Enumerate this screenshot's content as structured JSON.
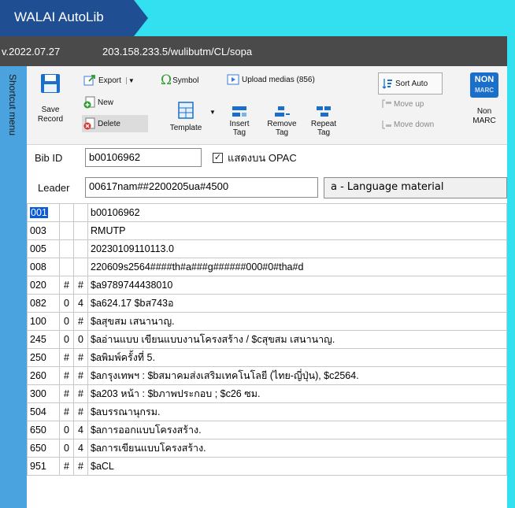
{
  "app": {
    "title": "WALAI AutoLib"
  },
  "infobar": {
    "version": "v.2022.07.27",
    "path": "203.158.233.5/wulibutm/CL/sopa"
  },
  "sidebar": {
    "label": "Shortcut menu"
  },
  "toolbar": {
    "save": "Save\nRecord",
    "save_line1": "Save",
    "save_line2": "Record",
    "export": "Export",
    "new": "New",
    "delete": "Delete",
    "symbol": "Symbol",
    "upload": "Upload medias (856)",
    "template": "Template",
    "insert_tag_1": "Insert",
    "insert_tag_2": "Tag",
    "remove_tag_1": "Remove",
    "remove_tag_2": "Tag",
    "repeat_tag_1": "Repeat",
    "repeat_tag_2": "Tag",
    "sort_auto": "Sort Auto",
    "move_up": "Move up",
    "move_down": "Move down",
    "nonmarc_badge_1": "NON",
    "nonmarc_badge_2": "MARC",
    "nonmarc_1": "Non",
    "nonmarc_2": "MARC"
  },
  "form": {
    "bib_id_label": "Bib ID",
    "bib_id_value": "b00106962",
    "opac_label": "แสดงบน OPAC",
    "opac_checked": true,
    "leader_label": "Leader",
    "leader_value": "00617nam##2200205ua#4500",
    "type_value": "a - Language material"
  },
  "marc": [
    {
      "tag": "001",
      "ind1": "",
      "ind2": "",
      "data": "b00106962"
    },
    {
      "tag": "003",
      "ind1": "",
      "ind2": "",
      "data": "RMUTP"
    },
    {
      "tag": "005",
      "ind1": "",
      "ind2": "",
      "data": "20230109110113.0"
    },
    {
      "tag": "008",
      "ind1": "",
      "ind2": "",
      "data": "220609s2564####th#a###g######000#0#tha#d"
    },
    {
      "tag": "020",
      "ind1": "#",
      "ind2": "#",
      "data": "$a9789744438010"
    },
    {
      "tag": "082",
      "ind1": "0",
      "ind2": "4",
      "data": "$a624.17 $bส743อ"
    },
    {
      "tag": "100",
      "ind1": "0",
      "ind2": "#",
      "data": "$aสุขสม เสนานาญ."
    },
    {
      "tag": "245",
      "ind1": "0",
      "ind2": "0",
      "data": "$aอ่านแบบ เขียนแบบงานโครงสร้าง / $cสุขสม เสนานาญ."
    },
    {
      "tag": "250",
      "ind1": "#",
      "ind2": "#",
      "data": "$aพิมพ์ครั้งที่ 5."
    },
    {
      "tag": "260",
      "ind1": "#",
      "ind2": "#",
      "data": "$aกรุงเทพฯ : $bสมาคมส่งเสริมเทคโนโลยี (ไทย-ญี่ปุ่น), $c2564."
    },
    {
      "tag": "300",
      "ind1": "#",
      "ind2": "#",
      "data": "$a203 หน้า : $bภาพประกอบ ; $c26 ซม."
    },
    {
      "tag": "504",
      "ind1": "#",
      "ind2": "#",
      "data": "$aบรรณานุกรม."
    },
    {
      "tag": "650",
      "ind1": "0",
      "ind2": "4",
      "data": "$aการออกแบบโครงสร้าง."
    },
    {
      "tag": "650",
      "ind1": "0",
      "ind2": "4",
      "data": "$aการเขียนแบบโครงสร้าง."
    },
    {
      "tag": "951",
      "ind1": "#",
      "ind2": "#",
      "data": "$aCL"
    }
  ],
  "colors": {
    "accent": "#33e0f0",
    "title_bar": "#1f4f92",
    "info_bar": "#4a4a4a",
    "sidebar": "#4aa3df",
    "selection": "#0a5bd8"
  }
}
